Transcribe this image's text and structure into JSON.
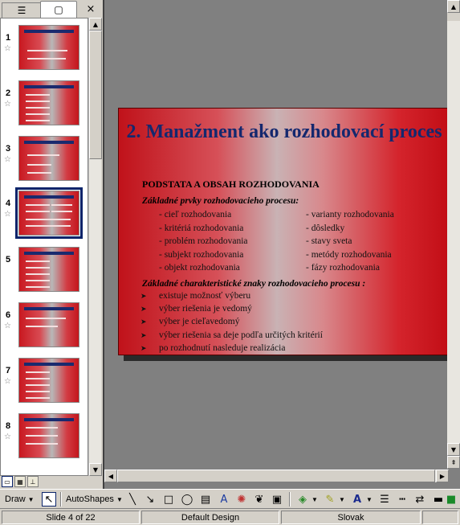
{
  "left_pane": {
    "tabs": [
      {
        "name": "outline-tab",
        "icon": "outline-icon"
      },
      {
        "name": "slides-tab",
        "icon": "slides-icon"
      }
    ],
    "close_label": "×",
    "thumbnails": [
      {
        "number": "1",
        "has_transition": true
      },
      {
        "number": "2",
        "has_transition": true
      },
      {
        "number": "3",
        "has_transition": true
      },
      {
        "number": "4",
        "has_transition": true,
        "selected": true
      },
      {
        "number": "5",
        "has_transition": false
      },
      {
        "number": "6",
        "has_transition": true
      },
      {
        "number": "7",
        "has_transition": true
      },
      {
        "number": "8",
        "has_transition": true
      }
    ]
  },
  "slide": {
    "title": "2. Manažment ako rozhodovací proces",
    "subheading": "PODSTATA A OBSAH ROZHODOVANIA",
    "label_elements": "Základné prvky rozhodovacieho procesu:",
    "elements_left": [
      "- cieľ rozhodovania",
      "- kritériá rozhodovania",
      "- problém rozhodovania",
      "- subjekt rozhodovania",
      "- objekt rozhodovania"
    ],
    "elements_right": [
      "- varianty rozhodovania",
      "- dôsledky",
      "- stavy sveta",
      "- metódy rozhodovania",
      "- fázy rozhodovania"
    ],
    "label_characteristics": "Základné charakteristické znaky rozhodovacieho procesu :",
    "characteristics": [
      "existuje možnosť výberu",
      "výber riešenia je vedomý",
      "výber je cieľavedomý",
      "výber riešenia sa deje podľa určitých kritérií",
      "po rozhodnutí nasleduje realizácia"
    ]
  },
  "drawing_toolbar": {
    "draw_label": "Draw",
    "autoshapes_label": "AutoShapes"
  },
  "status_bar": {
    "slide_info": "Slide 4 of 22",
    "design": "Default Design",
    "language": "Slovak"
  },
  "colors": {
    "slide_red": "#c81820",
    "title_blue": "#14286e",
    "selection": "#0a246a"
  }
}
